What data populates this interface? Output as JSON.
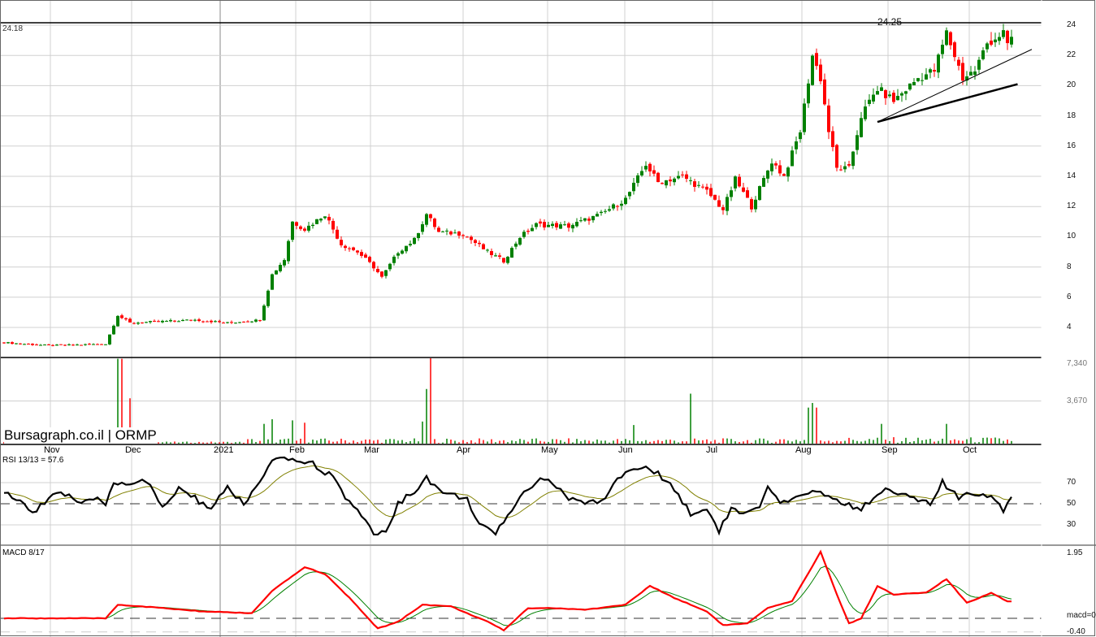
{
  "header": {
    "last_price": "24.18",
    "resistance_label": "24.25",
    "brand": "Bursagraph.co.il | ORMP"
  },
  "indicators": {
    "rsi_label": "RSI 13/13 = 57.6",
    "macd_label": "MACD 8/17"
  },
  "axes": {
    "price_ticks": [
      "24",
      "22",
      "20",
      "18",
      "16",
      "14",
      "12",
      "10",
      "8",
      "6",
      "4"
    ],
    "volume_ticks": [
      "7,340",
      "3,670"
    ],
    "rsi_ticks": [
      "70",
      "50",
      "30"
    ],
    "macd_ticks": [
      "1.95",
      "macd=0",
      "-0.40"
    ]
  },
  "months": [
    "Nov",
    "Dec",
    "2021",
    "Feb",
    "Mar",
    "Apr",
    "May",
    "Jun",
    "Jul",
    "Aug",
    "Sep",
    "Oct"
  ],
  "colors": {
    "up": "#008000",
    "down": "#ff0000",
    "rsi": "#000000",
    "rsi_signal": "#808000",
    "macd": "#ff0000",
    "macd_signal": "#008000"
  },
  "chart_data": {
    "type": "candlestick",
    "title": "ORMP",
    "x_unit": "trading day index",
    "price_range": [
      3,
      24.25
    ],
    "resistance": 24.25,
    "trendlines": [
      {
        "from": [
          215,
          17.6
        ],
        "to": [
          253,
          22.4
        ]
      },
      {
        "from": [
          215,
          17.6
        ],
        "to": [
          249.5,
          20.1
        ]
      }
    ],
    "close_keypoints": [
      [
        0,
        3.0
      ],
      [
        11,
        2.8
      ],
      [
        25,
        2.9
      ],
      [
        28,
        4.8
      ],
      [
        31,
        4.3
      ],
      [
        39,
        4.4
      ],
      [
        47,
        4.5
      ],
      [
        55,
        4.3
      ],
      [
        63,
        4.5
      ],
      [
        64,
        5.5
      ],
      [
        66,
        7.5
      ],
      [
        69,
        8.5
      ],
      [
        71,
        11
      ],
      [
        74,
        10.5
      ],
      [
        79,
        11.5
      ],
      [
        83,
        9.5
      ],
      [
        87,
        9
      ],
      [
        91,
        8
      ],
      [
        93,
        7.3
      ],
      [
        97,
        9
      ],
      [
        101,
        9.8
      ],
      [
        104,
        11.5
      ],
      [
        107,
        10.3
      ],
      [
        113,
        10.2
      ],
      [
        119,
        9
      ],
      [
        123,
        8.4
      ],
      [
        127,
        10
      ],
      [
        131,
        10.8
      ],
      [
        139,
        10.7
      ],
      [
        147,
        11.5
      ],
      [
        153,
        12.5
      ],
      [
        158,
        14.8
      ],
      [
        161,
        13.6
      ],
      [
        167,
        14
      ],
      [
        173,
        13
      ],
      [
        177,
        11.8
      ],
      [
        180,
        13.8
      ],
      [
        184,
        12
      ],
      [
        189,
        15
      ],
      [
        192,
        14
      ],
      [
        196,
        17
      ],
      [
        199,
        22
      ],
      [
        201,
        20.5
      ],
      [
        203,
        17
      ],
      [
        205,
        14.5
      ],
      [
        208,
        14.5
      ],
      [
        211,
        18
      ],
      [
        215,
        19.8
      ],
      [
        219,
        19
      ],
      [
        225,
        20.5
      ],
      [
        229,
        21
      ],
      [
        232,
        23.5
      ],
      [
        236,
        20.5
      ],
      [
        239,
        21
      ],
      [
        242,
        22.8
      ],
      [
        246,
        23.5
      ],
      [
        247,
        22.5
      ],
      [
        248,
        23.2
      ]
    ],
    "volume_max": 7340,
    "volume_spikes": [
      [
        28,
        7300
      ],
      [
        29,
        7300
      ],
      [
        31,
        3900
      ],
      [
        64,
        1700
      ],
      [
        66,
        2100
      ],
      [
        71,
        2000
      ],
      [
        74,
        1800
      ],
      [
        103,
        1900
      ],
      [
        104,
        4700
      ],
      [
        105,
        7340
      ],
      [
        155,
        1600
      ],
      [
        169,
        4300
      ],
      [
        198,
        3100
      ],
      [
        199,
        3500
      ],
      [
        200,
        3100
      ],
      [
        216,
        1700
      ],
      [
        232,
        1700
      ]
    ],
    "rsi_keypoints": [
      [
        0,
        62
      ],
      [
        7,
        42
      ],
      [
        13,
        62
      ],
      [
        17,
        55
      ],
      [
        19,
        48
      ],
      [
        22,
        55
      ],
      [
        25,
        50
      ],
      [
        27,
        70
      ],
      [
        31,
        70
      ],
      [
        35,
        72
      ],
      [
        39,
        45
      ],
      [
        43,
        65
      ],
      [
        47,
        55
      ],
      [
        51,
        45
      ],
      [
        55,
        65
      ],
      [
        59,
        50
      ],
      [
        63,
        70
      ],
      [
        66,
        90
      ],
      [
        71,
        92
      ],
      [
        76,
        88
      ],
      [
        81,
        75
      ],
      [
        85,
        50
      ],
      [
        89,
        35
      ],
      [
        92,
        18
      ],
      [
        95,
        30
      ],
      [
        97,
        50
      ],
      [
        101,
        62
      ],
      [
        104,
        75
      ],
      [
        108,
        60
      ],
      [
        114,
        55
      ],
      [
        117,
        30
      ],
      [
        121,
        20
      ],
      [
        124,
        40
      ],
      [
        129,
        65
      ],
      [
        132,
        75
      ],
      [
        135,
        70
      ],
      [
        139,
        55
      ],
      [
        143,
        50
      ],
      [
        148,
        55
      ],
      [
        151,
        75
      ],
      [
        157,
        85
      ],
      [
        161,
        78
      ],
      [
        165,
        65
      ],
      [
        169,
        40
      ],
      [
        173,
        45
      ],
      [
        176,
        25
      ],
      [
        179,
        45
      ],
      [
        182,
        40
      ],
      [
        186,
        45
      ],
      [
        188,
        65
      ],
      [
        191,
        50
      ],
      [
        196,
        55
      ],
      [
        199,
        65
      ],
      [
        202,
        58
      ],
      [
        207,
        50
      ],
      [
        211,
        45
      ],
      [
        215,
        60
      ],
      [
        218,
        65
      ],
      [
        223,
        55
      ],
      [
        228,
        50
      ],
      [
        231,
        70
      ],
      [
        235,
        55
      ],
      [
        239,
        60
      ],
      [
        243,
        58
      ],
      [
        246,
        45
      ],
      [
        248,
        58
      ]
    ],
    "rsi_range": [
      0,
      100
    ],
    "macd_keypoints": [
      [
        0,
        0
      ],
      [
        25,
        0
      ],
      [
        28,
        0.4
      ],
      [
        39,
        0.3
      ],
      [
        49,
        0.2
      ],
      [
        61,
        0.15
      ],
      [
        66,
        0.8
      ],
      [
        74,
        1.5
      ],
      [
        79,
        1.3
      ],
      [
        85,
        0.6
      ],
      [
        92,
        -0.3
      ],
      [
        97,
        -0.1
      ],
      [
        103,
        0.4
      ],
      [
        110,
        0.35
      ],
      [
        119,
        -0.1
      ],
      [
        123,
        -0.35
      ],
      [
        129,
        0.3
      ],
      [
        135,
        0.3
      ],
      [
        143,
        0.25
      ],
      [
        153,
        0.4
      ],
      [
        159,
        0.95
      ],
      [
        165,
        0.6
      ],
      [
        173,
        0.2
      ],
      [
        177,
        -0.2
      ],
      [
        183,
        -0.15
      ],
      [
        188,
        0.3
      ],
      [
        194,
        0.5
      ],
      [
        201,
        1.95
      ],
      [
        205,
        0.7
      ],
      [
        208,
        -0.15
      ],
      [
        211,
        0
      ],
      [
        215,
        0.95
      ],
      [
        219,
        0.7
      ],
      [
        227,
        0.75
      ],
      [
        232,
        1.15
      ],
      [
        237,
        0.45
      ],
      [
        243,
        0.75
      ],
      [
        247,
        0.5
      ]
    ],
    "macd_range": [
      -0.4,
      1.95
    ]
  }
}
